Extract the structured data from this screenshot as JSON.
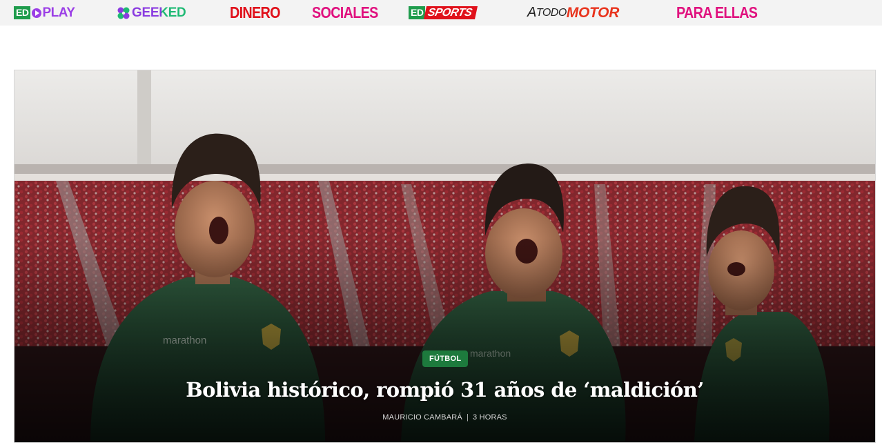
{
  "topbar": {
    "brands": [
      {
        "id": "edplay",
        "parts": [
          "ED",
          "PLAY"
        ]
      },
      {
        "id": "geeked",
        "label": "GEEKED"
      },
      {
        "id": "dinero",
        "label": "DINERO"
      },
      {
        "id": "sociales",
        "label": "SOCIALES"
      },
      {
        "id": "edsports",
        "parts": [
          "ED",
          "SPORTS"
        ]
      },
      {
        "id": "atodomotor",
        "parts": [
          "A",
          "TODO",
          "MOTOR"
        ]
      },
      {
        "id": "paraellas",
        "label": "PARA ELLAS"
      }
    ],
    "colors": {
      "edplay": "#9b3fe6",
      "ed_green": "#1f9c4c",
      "dinero": "#e0111b",
      "sociales": "#e0127f",
      "sports": "#e0111b",
      "motor": "#e8331c",
      "paraellas": "#e0127f"
    }
  },
  "hero": {
    "category": "FÚTBOL",
    "headline": "Bolivia histórico, rompió 31 años de ‘maldición’",
    "author": "MAURICIO CAMBARÁ",
    "time": "3 HORAS",
    "badge_color": "#1d7a3d"
  }
}
